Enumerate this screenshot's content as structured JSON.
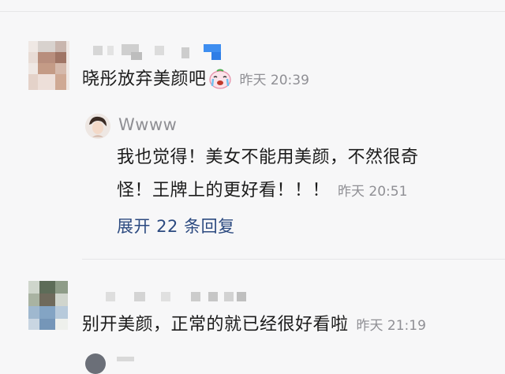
{
  "comments": [
    {
      "text": "晓彤放弃美颜吧",
      "emoji_icon": "crying-face-emoji",
      "time": "昨天 20:39",
      "reply": {
        "username": "Wwww",
        "text_line1": "我也觉得！美女不能用美颜，不然很奇",
        "text_line2": "怪！王牌上的更好看！！！",
        "time": "昨天 20:51"
      },
      "expand_label": "展开 22 条回复"
    },
    {
      "text": "别开美颜，正常的就已经很好看啦",
      "time": "昨天 21:19"
    }
  ],
  "colors": {
    "background": "#f7f7f8",
    "text": "#1b1b1b",
    "muted": "#8f8f94",
    "link": "#2c4a80",
    "divider": "#e6e6e8"
  }
}
